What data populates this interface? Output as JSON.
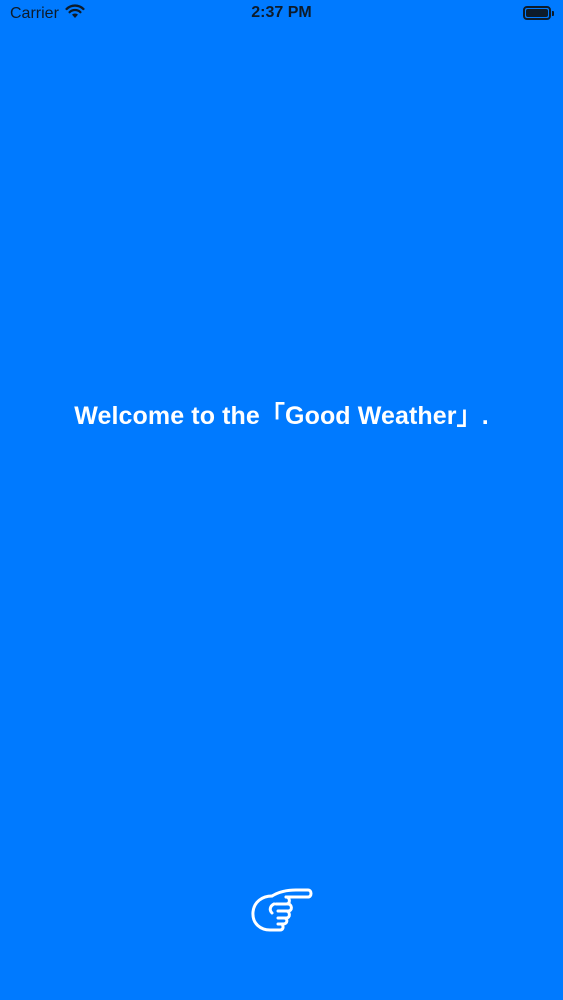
{
  "status_bar": {
    "carrier": "Carrier",
    "time": "2:37 PM",
    "wifi_icon": "wifi-icon",
    "battery_icon": "battery-icon"
  },
  "main": {
    "welcome_text": "Welcome to the「Good Weather」.",
    "next_icon": "pointing-hand-right-icon"
  },
  "colors": {
    "background": "#007AFF",
    "text": "#FFFFFF",
    "status_text": "#0D1B2A"
  }
}
